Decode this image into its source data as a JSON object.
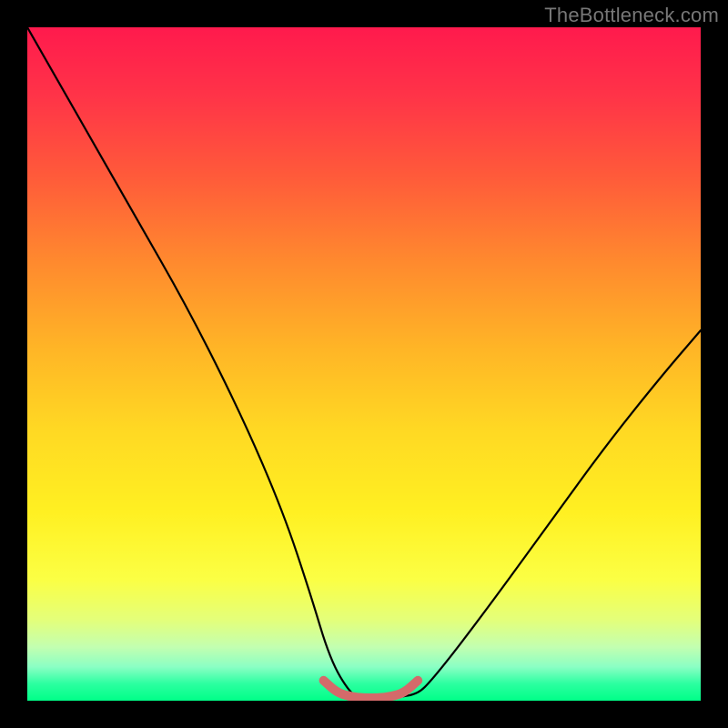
{
  "watermark": {
    "text": "TheBottleneck.com"
  },
  "chart_data": {
    "type": "line",
    "title": "",
    "xlabel": "",
    "ylabel": "",
    "xlim": [
      0,
      100
    ],
    "ylim": [
      0,
      100
    ],
    "grid": false,
    "series": [
      {
        "name": "curve",
        "x": [
          0,
          8,
          16,
          24,
          32,
          38,
          42,
          45,
          48,
          50,
          52,
          55,
          58,
          60,
          64,
          70,
          78,
          86,
          94,
          100
        ],
        "values": [
          100,
          86,
          72,
          58,
          42,
          28,
          16,
          6,
          1,
          0,
          0,
          0.5,
          1,
          3,
          8,
          16,
          27,
          38,
          48,
          55
        ]
      },
      {
        "name": "bottom-marker",
        "x": [
          44,
          46,
          48,
          50,
          52,
          54,
          56,
          58
        ],
        "values": [
          3,
          1.2,
          0.6,
          0.4,
          0.4,
          0.6,
          1.2,
          3
        ]
      }
    ],
    "annotations": []
  },
  "colors": {
    "curve": "#000000",
    "marker": "#d46a6a",
    "background_top": "#ff1a4d",
    "background_bottom": "#00ff88"
  }
}
